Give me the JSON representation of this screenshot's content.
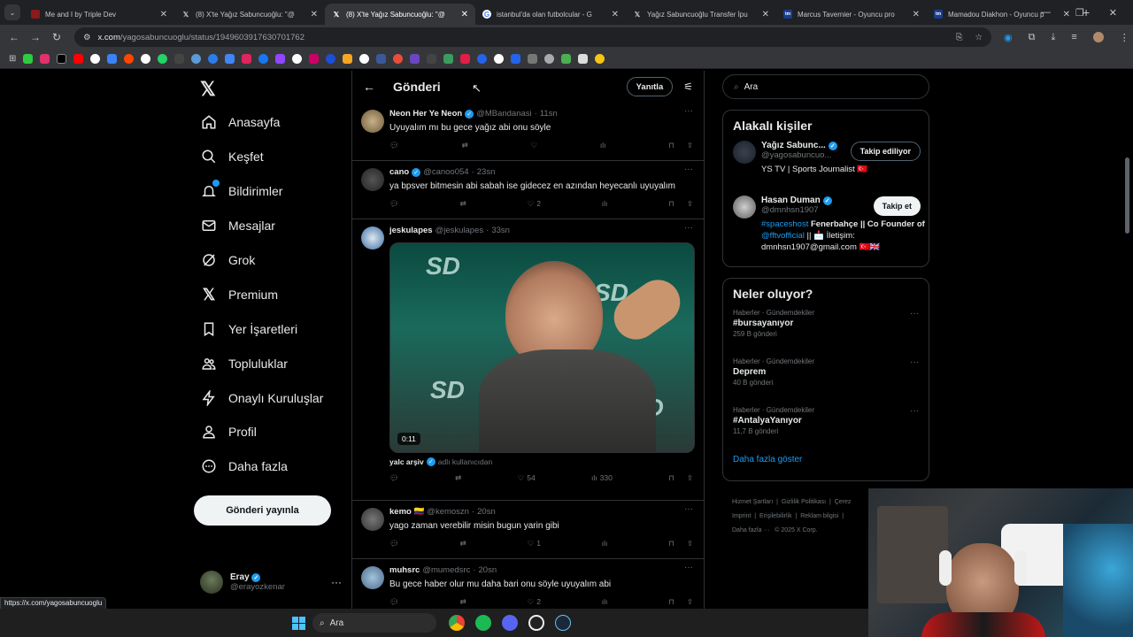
{
  "browser": {
    "tabs": [
      {
        "title": "Me and I by Triple Dev",
        "active": false
      },
      {
        "title": "(8) X'te Yağız Sabuncuoğlu: \"@",
        "active": false
      },
      {
        "title": "(8) X'te Yağız Sabuncuoğlu: \"@",
        "active": true
      },
      {
        "title": "istanbul'da olan futbolcular - G",
        "active": false
      },
      {
        "title": "Yağız Sabuncuoğlu Transfer İpu",
        "active": false
      },
      {
        "title": "Marcus Tavernier - Oyuncu pro",
        "active": false
      },
      {
        "title": "Mamadou Diakhon - Oyuncu p",
        "active": false
      }
    ],
    "url_host": "x.com",
    "url_path": "/yagosabuncuoglu/status/1949603917630701762",
    "status_url": "https://x.com/yagosabuncuoglu"
  },
  "sidebar": {
    "items": [
      {
        "label": "Anasayfa",
        "icon": "home-icon"
      },
      {
        "label": "Keşfet",
        "icon": "search-icon"
      },
      {
        "label": "Bildirimler",
        "icon": "bell-icon"
      },
      {
        "label": "Mesajlar",
        "icon": "mail-icon"
      },
      {
        "label": "Grok",
        "icon": "grok-icon"
      },
      {
        "label": "Premium",
        "icon": "x-icon"
      },
      {
        "label": "Yer İşaretleri",
        "icon": "bookmark-icon"
      },
      {
        "label": "Topluluklar",
        "icon": "community-icon"
      },
      {
        "label": "Onaylı Kuruluşlar",
        "icon": "lightning-icon"
      },
      {
        "label": "Profil",
        "icon": "person-icon"
      },
      {
        "label": "Daha fazla",
        "icon": "more-circle-icon"
      }
    ],
    "post_button": "Gönderi yayınla",
    "me": {
      "name": "Eray",
      "handle": "@erayozkenar"
    }
  },
  "main": {
    "title": "Gönderi",
    "reply_button": "Yanıtla",
    "posts": [
      {
        "name": "Neon Her Ye Neon",
        "verified": true,
        "handle": "@MBandanasi",
        "time": "11sn",
        "text": "Uyuyalım mı bu gece yağız abi onu söyle",
        "replies": "",
        "reposts": "",
        "likes": "",
        "views": ""
      },
      {
        "name": "cano",
        "verified": true,
        "handle": "@canoo054",
        "time": "23sn",
        "text": "ya bpsver bitmesin abi sabah ise gidecez en azından heyecanlı uyuyalım",
        "replies": "",
        "reposts": "",
        "likes": "2",
        "views": ""
      },
      {
        "name": "jeskulapes",
        "verified": false,
        "handle": "@jeskulapes",
        "time": "33sn",
        "text": "",
        "video_duration": "0:11",
        "credit_name": "yalc arşiv",
        "credit_suffix": "adlı kullanıcıdan",
        "replies": "",
        "reposts": "",
        "likes": "54",
        "views": "330"
      },
      {
        "name": "kemo 🇨🇴",
        "verified": false,
        "handle": "@kemoszn",
        "time": "20sn",
        "text": "yago zaman verebilir misin bugun yarin gibi",
        "replies": "",
        "reposts": "",
        "likes": "1",
        "views": ""
      },
      {
        "name": "muhsrc",
        "verified": false,
        "handle": "@mumedsrc",
        "time": "20sn",
        "text": "Bu gece haber olur mu daha bari onu söyle uyuyalım abi",
        "replies": "",
        "reposts": "",
        "likes": "2",
        "views": ""
      }
    ]
  },
  "right": {
    "search_placeholder": "Ara",
    "related_title": "Alakalı kişiler",
    "people": [
      {
        "name": "Yağız Sabunc...",
        "handle": "@yagosabuncuo...",
        "button": "Takip ediliyor",
        "bio": "YS TV | Sports Journalist 🇹🇷"
      },
      {
        "name": "Hasan Duman",
        "handle": "@dmnhsn1907",
        "button": "Takip et",
        "bio_tag": "#spaceshost",
        "bio_rest": "Fenerbahçe || Co Founder of",
        "bio_mention": "@fftvofficial",
        "bio_end": "|| 📩 İletişim: dmnhsn1907@gmail.com 🇹🇷🇬🇧"
      }
    ],
    "trends_title": "Neler oluyor?",
    "trends": [
      {
        "category": "Haberler · Gündemdekiler",
        "tag": "#bursayanıyor",
        "posts": "259 B gönderi"
      },
      {
        "category": "Haberler · Gündemdekiler",
        "tag": "Deprem",
        "posts": "40 B gönderi"
      },
      {
        "category": "Haberler · Gündemdekiler",
        "tag": "#AntalyaYanıyor",
        "posts": "11,7 B gönderi"
      }
    ],
    "show_more": "Daha fazla göster",
    "footer": [
      "Hizmet Şartları",
      "Gizlilik Politikası",
      "Çerez",
      "Imprint",
      "Erişilebilirlik",
      "Reklam bilgisi",
      "Daha fazla ···",
      "© 2025 X Corp."
    ]
  },
  "taskbar": {
    "search": "Ara"
  },
  "colors": {
    "accent": "#1d9bf0",
    "bg": "#000000",
    "border": "#2f3336",
    "muted": "#71767b"
  }
}
